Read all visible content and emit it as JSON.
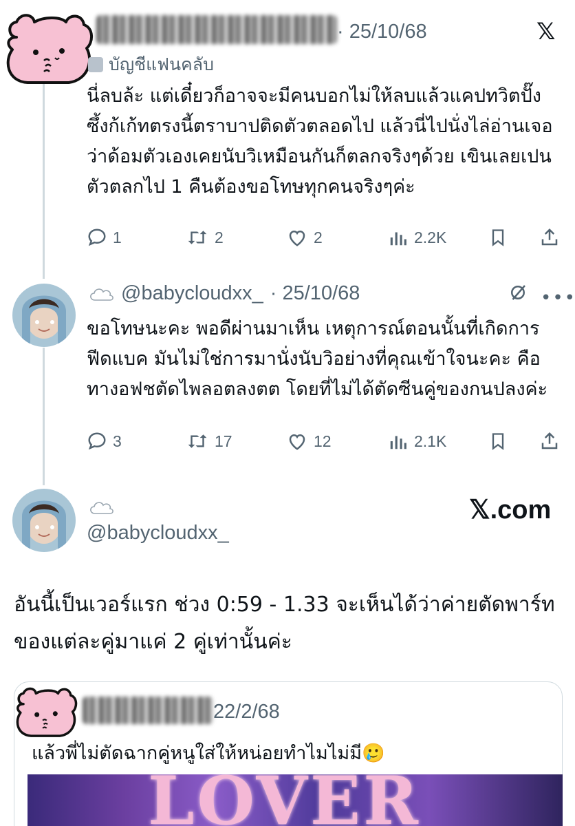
{
  "tweet1": {
    "date": "· 25/10/68",
    "badge": "บัญชีแฟนคลับ",
    "platform_icon": "x-logo-icon",
    "text": "นี่ลบล้ะ แต่เดี๋ยวก็อาจจะมีคนบอกไม่ให้ลบแล้วแคปทวิตปั๊ง ซึ้งก้เก้ทตรงนี้ตราบาปติดตัวตลอดไป แล้วนี่ไปนั่งไล่อ่านเจอว่าด้อมตัวเองเคยนับวิเหมือนกันก็ตลกจริงๆด้วย เขินเลยเปนตัวตลกไป 1 คืนต้องขอโทษทุกคนจริงๆค่ะ",
    "replies": "1",
    "retweets": "2",
    "likes": "2",
    "views": "2.2K"
  },
  "tweet2": {
    "handle": "@babycloudxx_",
    "date": "· 25/10/68",
    "text": "ขอโทษนะคะ พอดีผ่านมาเห็น เหตุการณ์ตอนนั้นที่เกิดการฟีดแบค มันไม่ใช่การมานั่งนับวิอย่างที่คุณเข้าใจนะคะ คือทางอฟชตัดไพลอตลงตต โดยที่ไม่ได้ตัดซีนคู่ของกนปลงค่ะ",
    "replies": "3",
    "retweets": "17",
    "likes": "12",
    "views": "2.1K"
  },
  "tweet3": {
    "handle": "@babycloudxx_",
    "site": "𝕏.com",
    "text": "อันนี้เป็นเวอร์แรก ช่วง 0:59 - 1.33 จะเห็นได้ว่าค่ายตัดพาร์ทของแต่ละคู่มาแค่ 2 คู่เท่านั้นค่ะ"
  },
  "quote": {
    "date": "22/2/68",
    "text": "แล้วพี่ไม่ตัดฉากคู่หนูใส่ให้หน่อยทำไมไม่มี🥲",
    "media_text": "LOVER"
  },
  "colors": {
    "text": "#0f1419",
    "muted": "#536471",
    "mascot_pink": "#f7c1d3",
    "thread_line": "#cfd9de"
  }
}
